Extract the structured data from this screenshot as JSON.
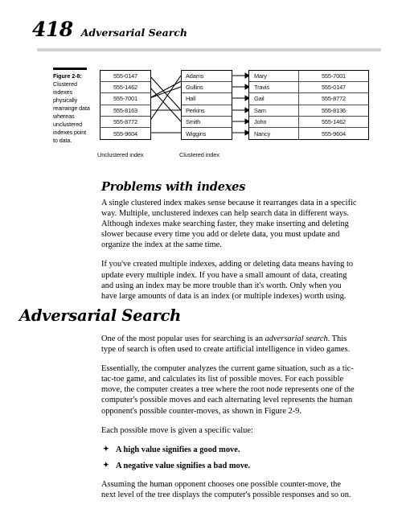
{
  "header": {
    "folio": "418",
    "running_title": "Adversarial Search"
  },
  "figure": {
    "number": "Figure 2-8:",
    "caption": "Clustered indexes physically rearrange data whereas unclustered indexes point to data.",
    "unclustered_label": "Unclustered index",
    "clustered_label": "Clustered index",
    "unclustered_index": [
      "555-0147",
      "555-1462",
      "555-7001",
      "555-8163",
      "555-8772",
      "555-9604"
    ],
    "clustered_index": [
      "Adams",
      "Gullins",
      "Hall",
      "Perkins",
      "Smith",
      "Wiggins"
    ],
    "data_table": {
      "rows": [
        {
          "name": "Mary",
          "phone": "555-7001"
        },
        {
          "name": "Travis",
          "phone": "555-0147"
        },
        {
          "name": "Gail",
          "phone": "555-8772"
        },
        {
          "name": "Sam",
          "phone": "555-8136"
        },
        {
          "name": "John",
          "phone": "555-1462"
        },
        {
          "name": "Nancy",
          "phone": "555-9604"
        }
      ]
    }
  },
  "sections": {
    "problems_heading": "Problems with indexes",
    "problems_p1": "A single clustered index makes sense because it rearranges data in a specific way. Multiple, unclustered indexes can help search data in different ways. Although indexes make searching faster, they make inserting and deleting slower because every time you add or delete data, you must update and organize the index at the same time.",
    "problems_p2": "If you've created multiple indexes, adding or deleting data means having to update every multiple index. If you have a small amount of data, creating and using an index may be more trouble than it's worth. Only when you have large amounts of data is an index (or multiple indexes) worth using.",
    "adversarial_heading": "Adversarial Search",
    "adversarial_p1_before": "One of the most popular uses for searching is an ",
    "adversarial_p1_italic": "adversarial search",
    "adversarial_p1_after": ". This type of search is often used to create artificial intelligence in video games.",
    "adversarial_p2": "Essentially, the computer analyzes the current game situation, such as a tic-tac-toe game, and calculates its list of possible moves. For each possible move, the computer creates a tree where the root node represents one of the computer's possible moves and each alternating level represents the human opponent's possible counter-moves, as shown in Figure 2-9.",
    "adversarial_p3": "Each possible move is given a specific value:",
    "bullets": [
      "A high value signifies a good move.",
      "A negative value signifies a bad move."
    ],
    "bullet_mark": "✦",
    "adversarial_p4": "Assuming the human opponent chooses one possible counter-move, the next level of the tree displays the computer's possible responses and so on."
  },
  "colors": {
    "header_rule": "#d2d2d2",
    "table_border": "#000000",
    "cell_divider": "#4a4a4a",
    "text": "#000000"
  }
}
